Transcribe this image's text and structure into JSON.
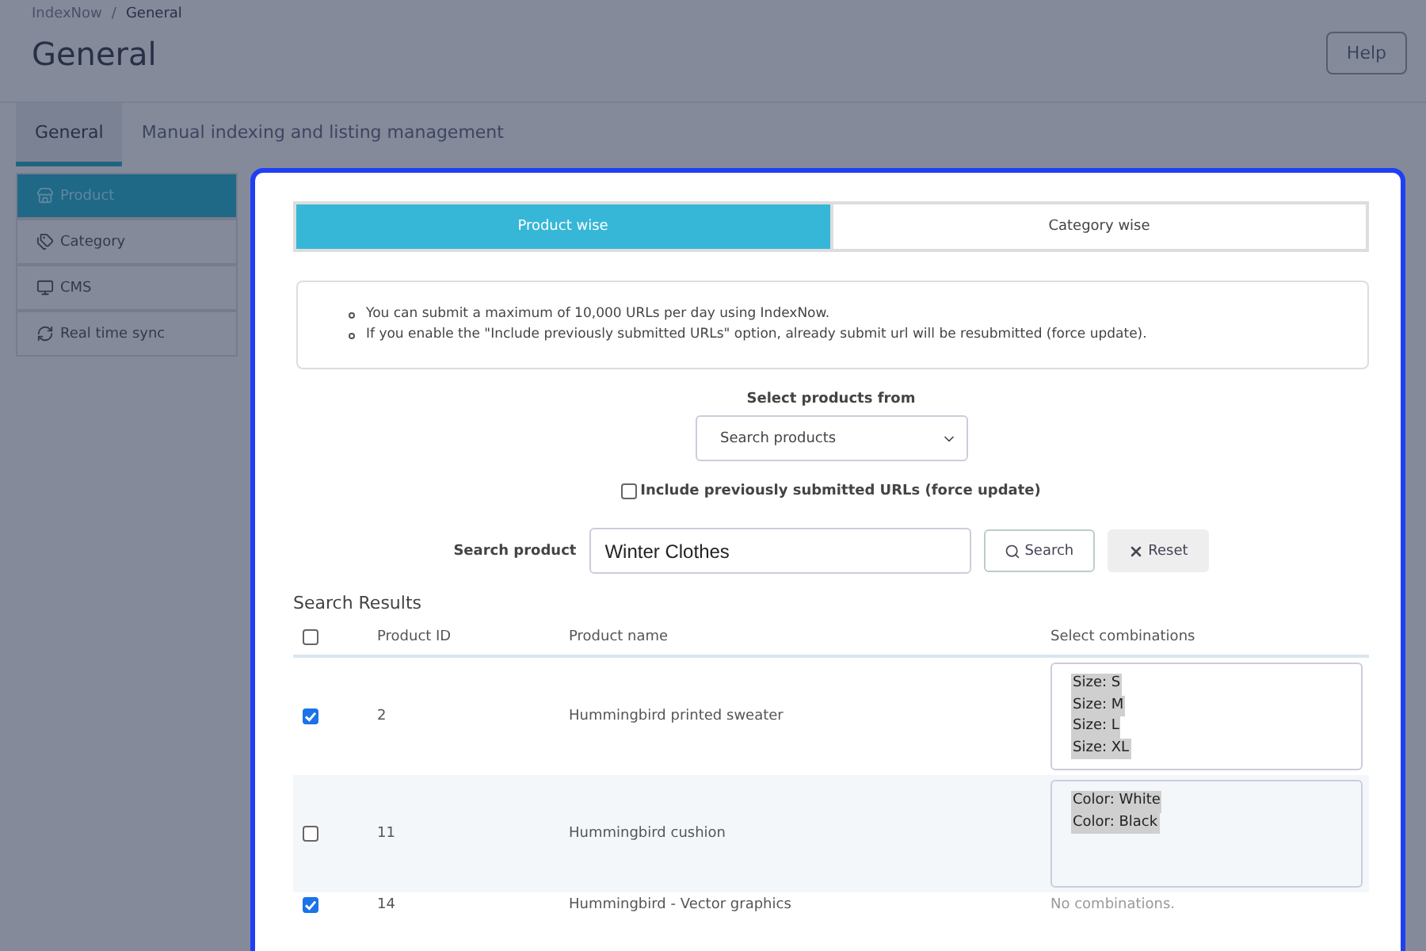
{
  "breadcrumb": [
    {
      "label": "IndexNow"
    },
    {
      "label": "General"
    }
  ],
  "breadcrumb_separator": "/",
  "page_title": "General",
  "help_button": "Help",
  "tabs": [
    {
      "label": "General",
      "selected": true
    },
    {
      "label": "Manual indexing and listing management",
      "selected": false
    }
  ],
  "sidebar": {
    "items": [
      {
        "label": "Product",
        "selected": true
      },
      {
        "label": "Category",
        "selected": false
      },
      {
        "label": "CMS",
        "selected": false
      },
      {
        "label": "Real time sync",
        "selected": false
      }
    ]
  },
  "modal": {
    "mode_tabs": [
      {
        "label": "Product wise",
        "selected": true
      },
      {
        "label": "Category wise",
        "selected": false
      }
    ],
    "notes": [
      "You can submit a maximum of 10,000 URLs per day using IndexNow.",
      "If you enable the \"Include previously submitted URLs\" option, already submit url will be resubmitted (force update)."
    ],
    "select_label": "Select products from",
    "select_value": "Search products",
    "include_previous": {
      "label": "Include previously submitted URLs (force update)",
      "checked": false
    },
    "search_label": "Search product",
    "search_value": "Winter Clothes",
    "search_button": "Search",
    "reset_button": "Reset",
    "results_title": "Search Results",
    "table": {
      "select_all_checked": false,
      "columns": [
        "Product ID",
        "Product name",
        "Select combinations"
      ],
      "rows": [
        {
          "checked": true,
          "id": "2",
          "name": "Hummingbird printed sweater",
          "kind": "combinations",
          "combinations": [
            {
              "label": "Size: S",
              "selected": true
            },
            {
              "label": "Size: M",
              "selected": true
            },
            {
              "label": "Size: L",
              "selected": true
            },
            {
              "label": "Size: XL",
              "selected": true
            }
          ]
        },
        {
          "checked": false,
          "id": "11",
          "name": "Hummingbird cushion",
          "kind": "combinations",
          "combinations": [
            {
              "label": "Color: White",
              "selected": true
            },
            {
              "label": "Color: Black",
              "selected": true
            }
          ]
        },
        {
          "checked": true,
          "id": "14",
          "name": "Hummingbird - Vector graphics",
          "kind": "none",
          "note": "No combinations."
        }
      ]
    }
  }
}
